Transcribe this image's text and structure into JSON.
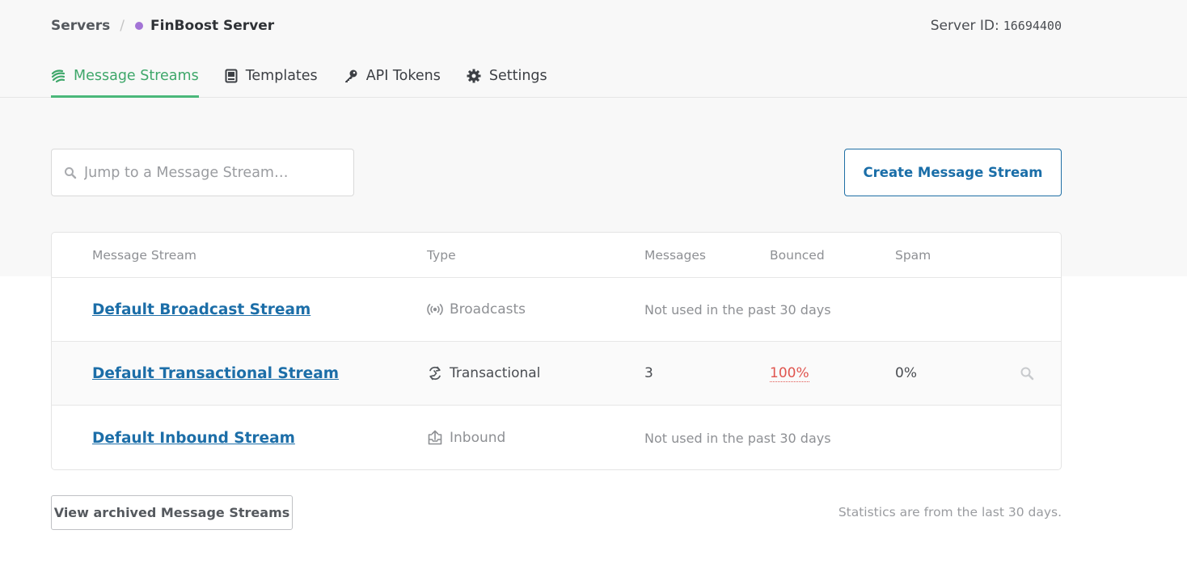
{
  "breadcrumb": {
    "servers_label": "Servers",
    "separator": "/",
    "server_name": "FinBoost Server",
    "server_color": "#a374d6"
  },
  "server_id": {
    "label": "Server ID:",
    "value": "16694400"
  },
  "tabs": [
    {
      "label": "Message Streams",
      "icon": "streams-icon",
      "active": true
    },
    {
      "label": "Templates",
      "icon": "template-icon",
      "active": false
    },
    {
      "label": "API Tokens",
      "icon": "key-icon",
      "active": false
    },
    {
      "label": "Settings",
      "icon": "gear-icon",
      "active": false
    }
  ],
  "search": {
    "placeholder": "Jump to a Message Stream…",
    "value": ""
  },
  "create_button": "Create Message Stream",
  "table": {
    "headers": {
      "stream": "Message Stream",
      "type": "Type",
      "messages": "Messages",
      "bounced": "Bounced",
      "spam": "Spam"
    },
    "rows": [
      {
        "name": "Default Broadcast Stream",
        "type": "Broadcasts",
        "type_icon": "broadcast-icon",
        "status": "Not used in the past 30 days"
      },
      {
        "name": "Default Transactional Stream",
        "type": "Transactional",
        "type_icon": "transactional-icon",
        "messages": "3",
        "bounced": "100%",
        "spam": "0%"
      },
      {
        "name": "Default Inbound Stream",
        "type": "Inbound",
        "type_icon": "inbound-icon",
        "status": "Not used in the past 30 days"
      }
    ]
  },
  "archived_button": "View archived Message Streams",
  "stats_note": "Statistics are from the last 30 days.",
  "colors": {
    "accent_green": "#3ea76a",
    "link_blue": "#1c6ea8",
    "bounce_red": "#e0554f"
  }
}
